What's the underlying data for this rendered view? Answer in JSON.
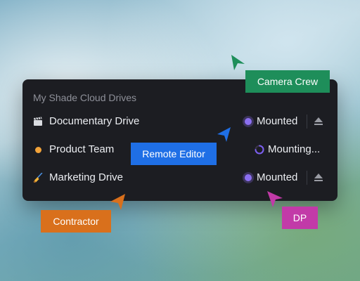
{
  "panel": {
    "title": "My Shade Cloud Drives",
    "drives": [
      {
        "label": "Documentary Drive",
        "icon": "clapperboard-icon",
        "icon_glyph": "🎬",
        "status": "Mounted",
        "status_color": "#8b6ff0",
        "ejectable": true
      },
      {
        "label": "Product Team",
        "icon": "orange-dot-icon",
        "icon_color": "#f2a33a",
        "status": "Mounting...",
        "status_color": "#7b5ff0",
        "ejectable": false
      },
      {
        "label": "Marketing Drive",
        "icon": "broom-icon",
        "icon_glyph": "🧹",
        "status": "Mounted",
        "status_color": "#8b6ff0",
        "ejectable": true
      }
    ]
  },
  "collaborators": [
    {
      "name": "Camera Crew",
      "color": "#1e8e5a"
    },
    {
      "name": "Remote Editor",
      "color": "#1f6fe6"
    },
    {
      "name": "Contractor",
      "color": "#d9701c"
    },
    {
      "name": "DP",
      "color": "#c23aa8"
    }
  ]
}
